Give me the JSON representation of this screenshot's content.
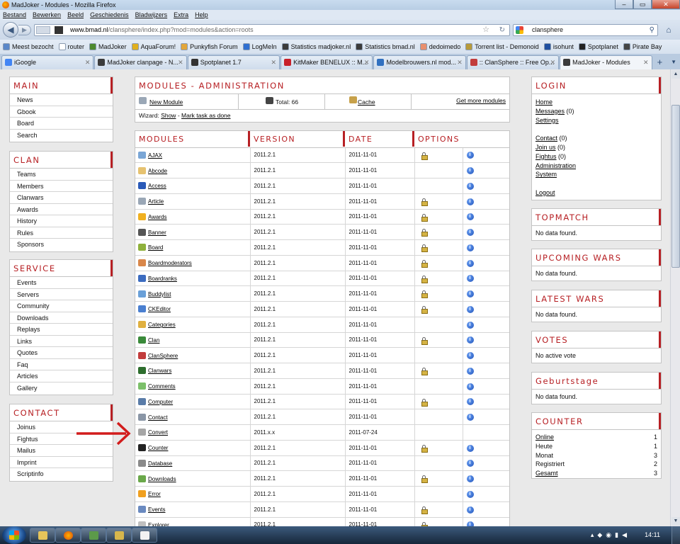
{
  "window": {
    "title": "MadJoker - Modules - Mozilla Firefox"
  },
  "menubar": [
    "Bestand",
    "Bewerken",
    "Beeld",
    "Geschiedenis",
    "Bladwijzers",
    "Extra",
    "Help"
  ],
  "address": {
    "domain": "www.bmad.nl",
    "path": "/clansphere/index.php?mod=modules&action=roots"
  },
  "search": {
    "value": "clansphere"
  },
  "bookmarks": [
    {
      "label": "Meest bezocht",
      "color": "#5a87c9"
    },
    {
      "label": "router",
      "color": "#ffffff"
    },
    {
      "label": "MadJoker",
      "color": "#4e8a2e"
    },
    {
      "label": "AquaForum!",
      "color": "#e0b020"
    },
    {
      "label": "Punkyfish Forum",
      "color": "#e2a63b"
    },
    {
      "label": "LogMeIn",
      "color": "#2f6fd1"
    },
    {
      "label": "Statistics madjoker.nl",
      "color": "#3b3b3b"
    },
    {
      "label": "Statistics bmad.nl",
      "color": "#3b3b3b"
    },
    {
      "label": "dedoimedo",
      "color": "#e88f6d"
    },
    {
      "label": "Torrent list - Demonoid",
      "color": "#b79a3a"
    },
    {
      "label": "isohunt",
      "color": "#1f4fa0"
    },
    {
      "label": "Spotplanet",
      "color": "#222222"
    },
    {
      "label": "Pirate Bay",
      "color": "#444444"
    }
  ],
  "tabs": [
    {
      "label": "iGoogle",
      "color": "#4285f4",
      "active": false
    },
    {
      "label": "MadJoker clanpage - N...",
      "color": "#3b3b3b",
      "active": false
    },
    {
      "label": "Spotplanet 1.7",
      "color": "#333333",
      "active": false
    },
    {
      "label": "KitMaker BENELUX :: M...",
      "color": "#c8202a",
      "active": false
    },
    {
      "label": "Modelbrouwers.nl mod...",
      "color": "#3070c0",
      "active": false
    },
    {
      "label": ":: ClanSphere :: Free Op...",
      "color": "#c23c3c",
      "active": false
    },
    {
      "label": "MadJoker - Modules",
      "color": "#3b3b3b",
      "active": true
    }
  ],
  "left_nav": [
    {
      "title": "MAIN",
      "items": [
        "News",
        "Gbook",
        "Board",
        "Search"
      ]
    },
    {
      "title": "CLAN",
      "items": [
        "Teams",
        "Members",
        "Clanwars",
        "Awards",
        "History",
        "Rules",
        "Sponsors"
      ]
    },
    {
      "title": "SERVICE",
      "items": [
        "Events",
        "Servers",
        "Community",
        "Downloads",
        "Replays",
        "Links",
        "Quotes",
        "Faq",
        "Articles",
        "Gallery"
      ]
    },
    {
      "title": "CONTACT",
      "items": [
        "Joinus",
        "Fightus",
        "Mailus",
        "Imprint",
        "Scriptinfo"
      ]
    }
  ],
  "admin": {
    "title": "MODULES - ADMINISTRATION",
    "new_module": "New Module",
    "total": "Total: 66",
    "cache": "Cache",
    "get_more": "Get more modules",
    "wizard_prefix": "Wizard:",
    "wizard_show": "Show",
    "wizard_sep": "-",
    "wizard_mark": "Mark task as done"
  },
  "modules": {
    "headers": [
      "MODULES",
      "VERSION",
      "DATE",
      "OPTIONS"
    ],
    "rows": [
      {
        "name": "AJAX",
        "version": "2011.2.1",
        "date": "2011-11-01",
        "lock": true,
        "icon": "#7aa6d6"
      },
      {
        "name": "Abcode",
        "version": "2011.2.1",
        "date": "2011-11-01",
        "lock": false,
        "icon": "#e6c270"
      },
      {
        "name": "Access",
        "version": "2011.2.1",
        "date": "2011-11-01",
        "lock": false,
        "icon": "#2a5ab8"
      },
      {
        "name": "Article",
        "version": "2011.2.1",
        "date": "2011-11-01",
        "lock": true,
        "icon": "#9aa7b6"
      },
      {
        "name": "Awards",
        "version": "2011.2.1",
        "date": "2011-11-01",
        "lock": true,
        "icon": "#f0b020"
      },
      {
        "name": "Banner",
        "version": "2011.2.1",
        "date": "2011-11-01",
        "lock": true,
        "icon": "#555555"
      },
      {
        "name": "Board",
        "version": "2011.2.1",
        "date": "2011-11-01",
        "lock": true,
        "icon": "#8fb13c"
      },
      {
        "name": "Boardmoderators",
        "version": "2011.2.1",
        "date": "2011-11-01",
        "lock": true,
        "icon": "#d9874a"
      },
      {
        "name": "Boardranks",
        "version": "2011.2.1",
        "date": "2011-11-01",
        "lock": true,
        "icon": "#3c6cc0"
      },
      {
        "name": "Buddylist",
        "version": "2011.2.1",
        "date": "2011-11-01",
        "lock": true,
        "icon": "#6aa0d8"
      },
      {
        "name": "CKEditor",
        "version": "2011.2.1",
        "date": "2011-11-01",
        "lock": true,
        "icon": "#4a7fd0"
      },
      {
        "name": "Categories",
        "version": "2011.2.1",
        "date": "2011-11-01",
        "lock": false,
        "icon": "#e0b040"
      },
      {
        "name": "Clan",
        "version": "2011.2.1",
        "date": "2011-11-01",
        "lock": true,
        "icon": "#3a8a3a"
      },
      {
        "name": "ClanSphere",
        "version": "2011.2.1",
        "date": "2011-11-01",
        "lock": false,
        "icon": "#c23c3c"
      },
      {
        "name": "Clanwars",
        "version": "2011.2.1",
        "date": "2011-11-01",
        "lock": true,
        "icon": "#2d6d2d"
      },
      {
        "name": "Comments",
        "version": "2011.2.1",
        "date": "2011-11-01",
        "lock": false,
        "icon": "#7cc06a"
      },
      {
        "name": "Computer",
        "version": "2011.2.1",
        "date": "2011-11-01",
        "lock": true,
        "icon": "#5a7ca8"
      },
      {
        "name": "Contact",
        "version": "2011.2.1",
        "date": "2011-11-01",
        "lock": false,
        "icon": "#8a96a6"
      },
      {
        "name": "Convert",
        "version": "2011.x.x",
        "date": "2011-07-24",
        "lock": false,
        "icon": "#a6a6a6",
        "no_info": true
      },
      {
        "name": "Counter",
        "version": "2011.2.1",
        "date": "2011-11-01",
        "lock": true,
        "icon": "#222222"
      },
      {
        "name": "Database",
        "version": "2011.2.1",
        "date": "2011-11-01",
        "lock": false,
        "icon": "#8a8a8a"
      },
      {
        "name": "Downloads",
        "version": "2011.2.1",
        "date": "2011-11-01",
        "lock": true,
        "icon": "#6aa84a"
      },
      {
        "name": "Error",
        "version": "2011.2.1",
        "date": "2011-11-01",
        "lock": false,
        "icon": "#f0a020"
      },
      {
        "name": "Events",
        "version": "2011.2.1",
        "date": "2011-11-01",
        "lock": true,
        "icon": "#6a8ac0"
      },
      {
        "name": "Explorer",
        "version": "2011.2.1",
        "date": "2011-11-01",
        "lock": true,
        "icon": "#c0c0c0"
      }
    ]
  },
  "login": {
    "title": "LOGIN",
    "links1": [
      {
        "label": "Home",
        "count": ""
      },
      {
        "label": "Messages",
        "count": " (0)"
      },
      {
        "label": "Settings",
        "count": ""
      }
    ],
    "links2": [
      {
        "label": "Contact",
        "count": " (0)"
      },
      {
        "label": "Join us",
        "count": " (0)"
      },
      {
        "label": "Fightus",
        "count": " (0)"
      },
      {
        "label": "Administration",
        "count": ""
      },
      {
        "label": "System",
        "count": ""
      }
    ],
    "logout": "Logout"
  },
  "widgets": [
    {
      "title": "TOPMATCH",
      "text": "No data found."
    },
    {
      "title": "UPCOMING WARS",
      "text": "No data found."
    },
    {
      "title": "LATEST WARS",
      "text": "No data found."
    },
    {
      "title": "VOTES",
      "text": "No active vote"
    },
    {
      "title": "Geburtstage",
      "text": "No data found."
    }
  ],
  "counter": {
    "title": "COUNTER",
    "rows": [
      {
        "label": "Online",
        "value": "1",
        "link": true
      },
      {
        "label": "Heute",
        "value": "1",
        "link": false
      },
      {
        "label": "Monat",
        "value": "3",
        "link": false
      },
      {
        "label": "Registriert",
        "value": "2",
        "link": false
      },
      {
        "label": "Gesamt",
        "value": "3",
        "link": true
      }
    ]
  },
  "taskbar": {
    "clock": "14:11"
  },
  "colors": {
    "accent": "#b72024",
    "arrow": "#d21c1c"
  }
}
